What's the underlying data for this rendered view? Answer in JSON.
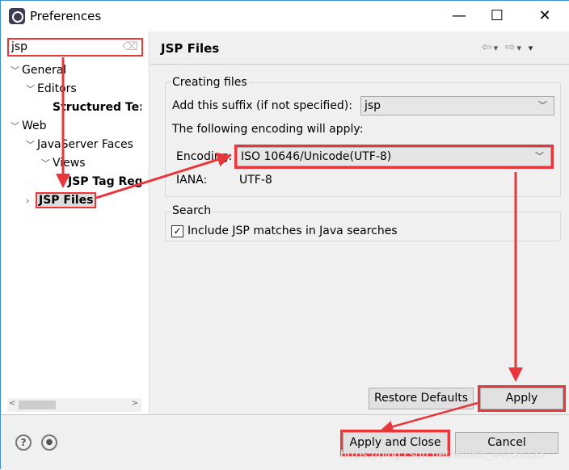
{
  "window": {
    "title": "Preferences",
    "minimize": "—",
    "maximize": "☐",
    "close": "✕"
  },
  "filter": {
    "value": "jsp"
  },
  "tree": [
    {
      "label": "General",
      "level": 0,
      "expanded": true
    },
    {
      "label": "Editors",
      "level": 1,
      "expanded": true
    },
    {
      "label": "Structured Te:",
      "level": 2,
      "bold": true
    },
    {
      "label": "Web",
      "level": 0,
      "expanded": true
    },
    {
      "label": "JavaServer Faces",
      "level": 1,
      "expanded": true
    },
    {
      "label": "Views",
      "level": 2,
      "expanded": true
    },
    {
      "label": "JSP Tag Reg",
      "level": 3,
      "bold": true
    },
    {
      "label": "JSP Files",
      "level": 1,
      "bold": true,
      "selected": true
    }
  ],
  "page": {
    "title": "JSP Files",
    "nav": {
      "back": "⇦",
      "forward": "⇨",
      "menu": "▾"
    },
    "creating": {
      "legend": "Creating files",
      "suffix_label": "Add this suffix (if not specified):",
      "suffix_value": "jsp",
      "encoding_note": "The following encoding will apply:",
      "encoding_label": "Encoding:",
      "encoding_value": "ISO 10646/Unicode(UTF-8)",
      "iana_label": "IANA:",
      "iana_value": "UTF-8"
    },
    "search": {
      "legend": "Search",
      "include_label": "Include JSP matches in Java searches",
      "include_checked": true
    }
  },
  "buttons": {
    "restore": "Restore Defaults",
    "apply": "Apply",
    "apply_close": "Apply and Close",
    "cancel": "Cancel"
  },
  "footer": {
    "help": "?",
    "info": "●"
  },
  "watermark": "https://blog.csdn.net/weixin_44731123",
  "colors": {
    "annotation": "#e8363a"
  }
}
